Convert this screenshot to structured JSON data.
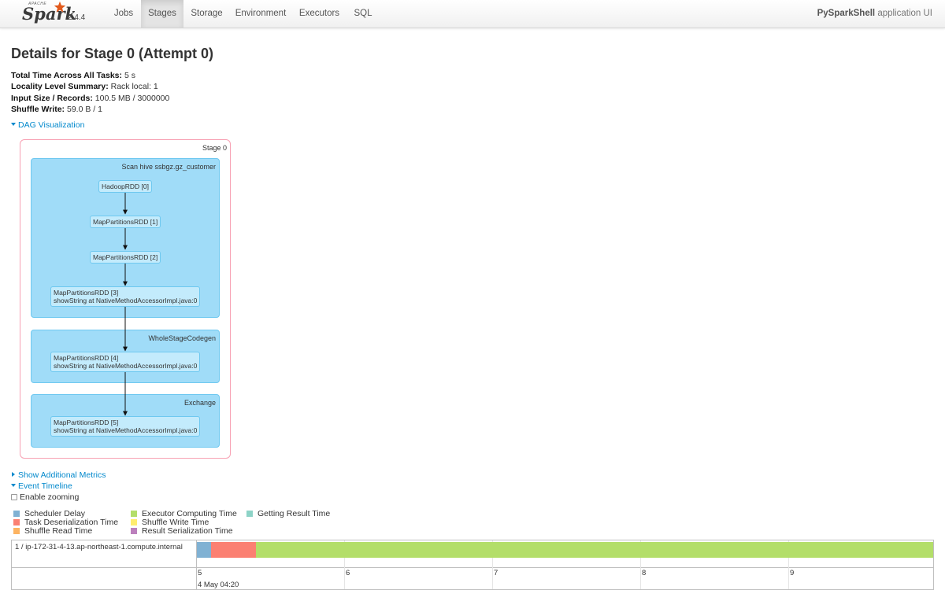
{
  "brand": {
    "apache": "APACHE",
    "spark": "Spark",
    "version": "2.4.4"
  },
  "nav": {
    "tabs": [
      {
        "label": "Jobs",
        "active": false
      },
      {
        "label": "Stages",
        "active": true
      },
      {
        "label": "Storage",
        "active": false
      },
      {
        "label": "Environment",
        "active": false
      },
      {
        "label": "Executors",
        "active": false
      },
      {
        "label": "SQL",
        "active": false
      }
    ],
    "app_name": "PySparkShell",
    "app_suffix": " application UI"
  },
  "page": {
    "title": "Details for Stage 0 (Attempt 0)",
    "summary": [
      {
        "key": "Total Time Across All Tasks:",
        "value": " 5 s"
      },
      {
        "key": "Locality Level Summary:",
        "value": " Rack local: 1"
      },
      {
        "key": "Input Size / Records:",
        "value": " 100.5 MB / 3000000"
      },
      {
        "key": "Shuffle Write:",
        "value": " 59.0 B / 1"
      }
    ]
  },
  "dag": {
    "toggle_label": "DAG Visualization",
    "stage_label": "Stage 0",
    "clusters": [
      {
        "label": "Scan hive ssbgz.gz_customer"
      },
      {
        "label": "WholeStageCodegen"
      },
      {
        "label": "Exchange"
      }
    ],
    "nodes": [
      {
        "line1": "HadoopRDD [0]",
        "line2": ""
      },
      {
        "line1": "MapPartitionsRDD [1]",
        "line2": ""
      },
      {
        "line1": "MapPartitionsRDD [2]",
        "line2": ""
      },
      {
        "line1": "MapPartitionsRDD [3]",
        "line2": "showString at NativeMethodAccessorImpl.java:0"
      },
      {
        "line1": "MapPartitionsRDD [4]",
        "line2": "showString at NativeMethodAccessorImpl.java:0"
      },
      {
        "line1": "MapPartitionsRDD [5]",
        "line2": "showString at NativeMethodAccessorImpl.java:0"
      }
    ]
  },
  "metrics_toggle": "Show Additional Metrics",
  "timeline": {
    "toggle_label": "Event Timeline",
    "zoom_label": "Enable zooming",
    "legend": [
      {
        "label": "Scheduler Delay",
        "color": "#80b1d3"
      },
      {
        "label": "Task Deserialization Time",
        "color": "#fb8072"
      },
      {
        "label": "Shuffle Read Time",
        "color": "#fdb462"
      },
      {
        "label": "Executor Computing Time",
        "color": "#b3de69"
      },
      {
        "label": "Shuffle Write Time",
        "color": "#ffed6f"
      },
      {
        "label": "Result Serialization Time",
        "color": "#bc80bd"
      },
      {
        "label": "Getting Result Time",
        "color": "#8dd3c7"
      }
    ],
    "executor": "1 / ip-172-31-4-13.ap-northeast-1.compute.internal",
    "ticks": [
      "5",
      "6",
      "7",
      "8",
      "9"
    ],
    "date_label": "4 May 04:20"
  }
}
